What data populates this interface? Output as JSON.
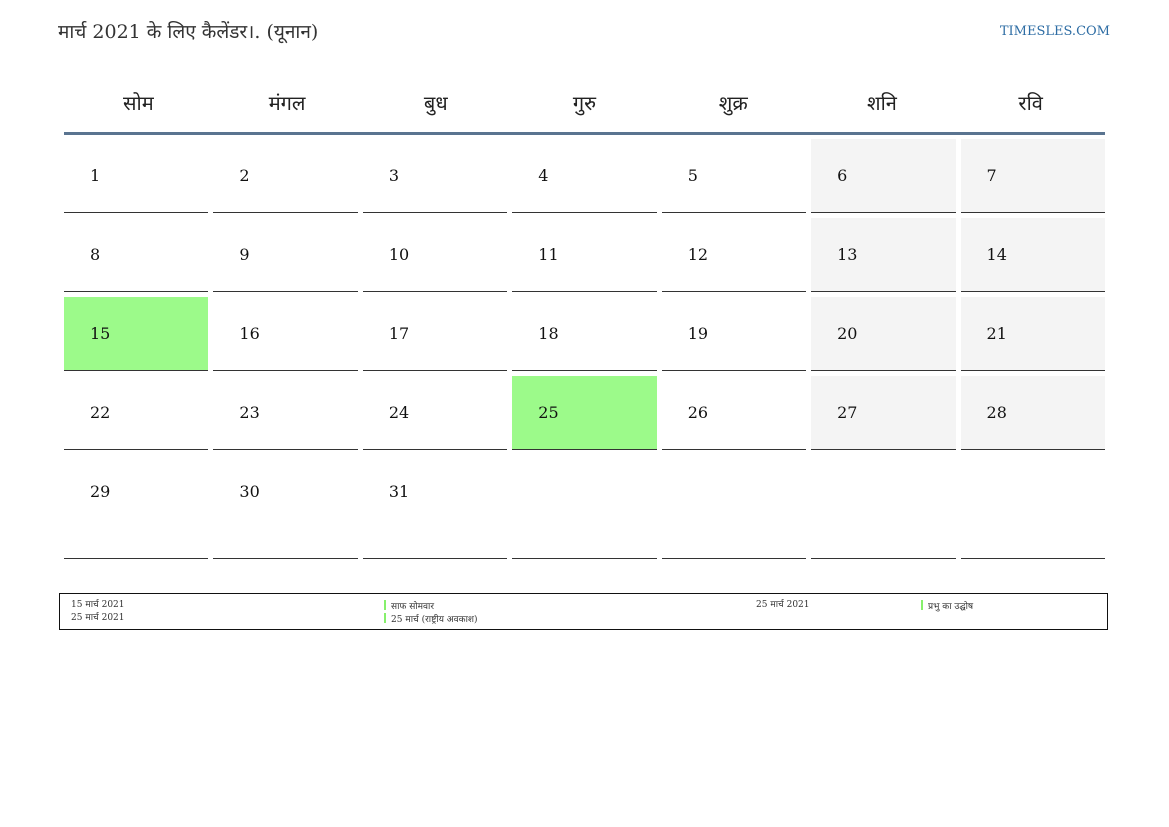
{
  "header": {
    "title": "मार्च 2021 के लिए कैलेंडर।. (यूनान)",
    "site": "TIMESLES.COM"
  },
  "weekdays": [
    "सोम",
    "मंगल",
    "बुध",
    "गुरु",
    "शुक्र",
    "शनि",
    "रवि"
  ],
  "weeks": [
    [
      "1",
      "2",
      "3",
      "4",
      "5",
      "6",
      "7"
    ],
    [
      "8",
      "9",
      "10",
      "11",
      "12",
      "13",
      "14"
    ],
    [
      "15",
      "16",
      "17",
      "18",
      "19",
      "20",
      "21"
    ],
    [
      "22",
      "23",
      "24",
      "25",
      "26",
      "27",
      "28"
    ],
    [
      "29",
      "30",
      "31",
      "",
      "",
      "",
      ""
    ]
  ],
  "holiday_dates": [
    "15",
    "25"
  ],
  "colors": {
    "holiday": "#9cfa8a",
    "weekend": "#f4f4f4",
    "header_rule": "#5a7490",
    "link": "#2e6da4"
  },
  "legend": [
    {
      "date": "15 मार्च 2021",
      "name": "साफ सोमवार"
    },
    {
      "date": "25 मार्च 2021",
      "name": "25 मार्च (राष्ट्रीय अवकाश)"
    },
    {
      "date": "25 मार्च 2021",
      "name": "प्रभु का उद्घोष"
    }
  ]
}
